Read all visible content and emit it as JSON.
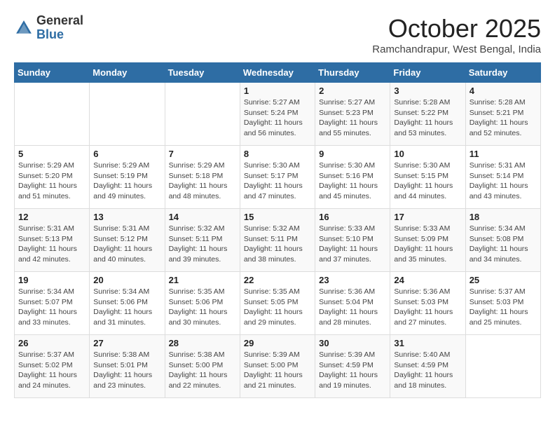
{
  "header": {
    "logo_general": "General",
    "logo_blue": "Blue",
    "month_title": "October 2025",
    "location": "Ramchandrapur, West Bengal, India"
  },
  "calendar": {
    "weekdays": [
      "Sunday",
      "Monday",
      "Tuesday",
      "Wednesday",
      "Thursday",
      "Friday",
      "Saturday"
    ],
    "weeks": [
      [
        {
          "day": "",
          "info": ""
        },
        {
          "day": "",
          "info": ""
        },
        {
          "day": "",
          "info": ""
        },
        {
          "day": "1",
          "info": "Sunrise: 5:27 AM\nSunset: 5:24 PM\nDaylight: 11 hours\nand 56 minutes."
        },
        {
          "day": "2",
          "info": "Sunrise: 5:27 AM\nSunset: 5:23 PM\nDaylight: 11 hours\nand 55 minutes."
        },
        {
          "day": "3",
          "info": "Sunrise: 5:28 AM\nSunset: 5:22 PM\nDaylight: 11 hours\nand 53 minutes."
        },
        {
          "day": "4",
          "info": "Sunrise: 5:28 AM\nSunset: 5:21 PM\nDaylight: 11 hours\nand 52 minutes."
        }
      ],
      [
        {
          "day": "5",
          "info": "Sunrise: 5:29 AM\nSunset: 5:20 PM\nDaylight: 11 hours\nand 51 minutes."
        },
        {
          "day": "6",
          "info": "Sunrise: 5:29 AM\nSunset: 5:19 PM\nDaylight: 11 hours\nand 49 minutes."
        },
        {
          "day": "7",
          "info": "Sunrise: 5:29 AM\nSunset: 5:18 PM\nDaylight: 11 hours\nand 48 minutes."
        },
        {
          "day": "8",
          "info": "Sunrise: 5:30 AM\nSunset: 5:17 PM\nDaylight: 11 hours\nand 47 minutes."
        },
        {
          "day": "9",
          "info": "Sunrise: 5:30 AM\nSunset: 5:16 PM\nDaylight: 11 hours\nand 45 minutes."
        },
        {
          "day": "10",
          "info": "Sunrise: 5:30 AM\nSunset: 5:15 PM\nDaylight: 11 hours\nand 44 minutes."
        },
        {
          "day": "11",
          "info": "Sunrise: 5:31 AM\nSunset: 5:14 PM\nDaylight: 11 hours\nand 43 minutes."
        }
      ],
      [
        {
          "day": "12",
          "info": "Sunrise: 5:31 AM\nSunset: 5:13 PM\nDaylight: 11 hours\nand 42 minutes."
        },
        {
          "day": "13",
          "info": "Sunrise: 5:31 AM\nSunset: 5:12 PM\nDaylight: 11 hours\nand 40 minutes."
        },
        {
          "day": "14",
          "info": "Sunrise: 5:32 AM\nSunset: 5:11 PM\nDaylight: 11 hours\nand 39 minutes."
        },
        {
          "day": "15",
          "info": "Sunrise: 5:32 AM\nSunset: 5:11 PM\nDaylight: 11 hours\nand 38 minutes."
        },
        {
          "day": "16",
          "info": "Sunrise: 5:33 AM\nSunset: 5:10 PM\nDaylight: 11 hours\nand 37 minutes."
        },
        {
          "day": "17",
          "info": "Sunrise: 5:33 AM\nSunset: 5:09 PM\nDaylight: 11 hours\nand 35 minutes."
        },
        {
          "day": "18",
          "info": "Sunrise: 5:34 AM\nSunset: 5:08 PM\nDaylight: 11 hours\nand 34 minutes."
        }
      ],
      [
        {
          "day": "19",
          "info": "Sunrise: 5:34 AM\nSunset: 5:07 PM\nDaylight: 11 hours\nand 33 minutes."
        },
        {
          "day": "20",
          "info": "Sunrise: 5:34 AM\nSunset: 5:06 PM\nDaylight: 11 hours\nand 31 minutes."
        },
        {
          "day": "21",
          "info": "Sunrise: 5:35 AM\nSunset: 5:06 PM\nDaylight: 11 hours\nand 30 minutes."
        },
        {
          "day": "22",
          "info": "Sunrise: 5:35 AM\nSunset: 5:05 PM\nDaylight: 11 hours\nand 29 minutes."
        },
        {
          "day": "23",
          "info": "Sunrise: 5:36 AM\nSunset: 5:04 PM\nDaylight: 11 hours\nand 28 minutes."
        },
        {
          "day": "24",
          "info": "Sunrise: 5:36 AM\nSunset: 5:03 PM\nDaylight: 11 hours\nand 27 minutes."
        },
        {
          "day": "25",
          "info": "Sunrise: 5:37 AM\nSunset: 5:03 PM\nDaylight: 11 hours\nand 25 minutes."
        }
      ],
      [
        {
          "day": "26",
          "info": "Sunrise: 5:37 AM\nSunset: 5:02 PM\nDaylight: 11 hours\nand 24 minutes."
        },
        {
          "day": "27",
          "info": "Sunrise: 5:38 AM\nSunset: 5:01 PM\nDaylight: 11 hours\nand 23 minutes."
        },
        {
          "day": "28",
          "info": "Sunrise: 5:38 AM\nSunset: 5:00 PM\nDaylight: 11 hours\nand 22 minutes."
        },
        {
          "day": "29",
          "info": "Sunrise: 5:39 AM\nSunset: 5:00 PM\nDaylight: 11 hours\nand 21 minutes."
        },
        {
          "day": "30",
          "info": "Sunrise: 5:39 AM\nSunset: 4:59 PM\nDaylight: 11 hours\nand 19 minutes."
        },
        {
          "day": "31",
          "info": "Sunrise: 5:40 AM\nSunset: 4:59 PM\nDaylight: 11 hours\nand 18 minutes."
        },
        {
          "day": "",
          "info": ""
        }
      ]
    ]
  }
}
